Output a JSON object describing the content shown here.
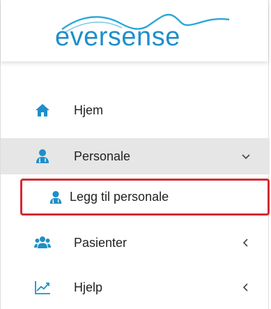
{
  "logo": {
    "text": "eversense"
  },
  "nav": {
    "home": {
      "label": "Hjem",
      "icon": "home-icon"
    },
    "personale": {
      "label": "Personale",
      "icon": "staff-icon",
      "chevron": "chevron-down-icon"
    },
    "legg_til": {
      "label": "Legg til personale",
      "icon": "staff-icon"
    },
    "pasienter": {
      "label": "Pasienter",
      "icon": "patients-icon",
      "chevron": "chevron-left-icon"
    },
    "hjelp": {
      "label": "Hjelp",
      "icon": "chart-line-icon",
      "chevron": "chevron-left-icon"
    }
  },
  "colors": {
    "accent": "#1f8fc9",
    "highlight_border": "#d32b33",
    "active_bg": "#e6e6e6"
  }
}
